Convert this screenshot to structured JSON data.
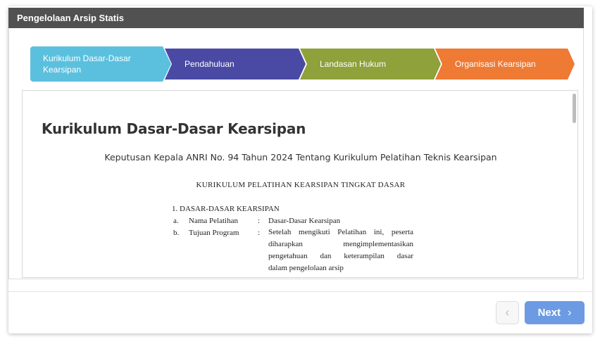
{
  "header": {
    "title": "Pengelolaan Arsip Statis"
  },
  "steps": [
    {
      "label": "Kurikulum Dasar-Dasar Kearsipan",
      "color": "#5bc0de",
      "active": true
    },
    {
      "label": "Pendahuluan",
      "color": "#4a4aa5"
    },
    {
      "label": "Landasan Hukum",
      "color": "#8ea13a"
    },
    {
      "label": "Organisasi Kearsipan",
      "color": "#ee7a34"
    }
  ],
  "document": {
    "title": "Kurikulum Dasar-Dasar Kearsipan",
    "subtitle": "Keputusan Kepala ANRI No. 94 Tahun 2024 Tentang Kurikulum Pelatihan Teknis Kearsipan",
    "scan": {
      "heading": "KURIKULUM PELATIHAN KEARSIPAN TINGKAT DASAR",
      "section": "1.   DASAR-DASAR KEARSIPAN",
      "item_a": {
        "letter": "a.",
        "label": "Nama Pelatihan",
        "colon": ":",
        "value": "Dasar-Dasar Kearsipan"
      },
      "item_b": {
        "letter": "b.",
        "label": "Tujuan Program",
        "colon": ":",
        "lines": [
          "Setelah mengikuti Pelatihan ini, peserta",
          "diharapkan mengimplementasikan",
          "pengetahuan dan keterampilan dasar",
          "dalam pengelolaan arsip"
        ]
      }
    }
  },
  "footer": {
    "prev_icon": "chevron-left-icon",
    "next_label": "Next",
    "next_icon": "chevron-right-icon"
  }
}
